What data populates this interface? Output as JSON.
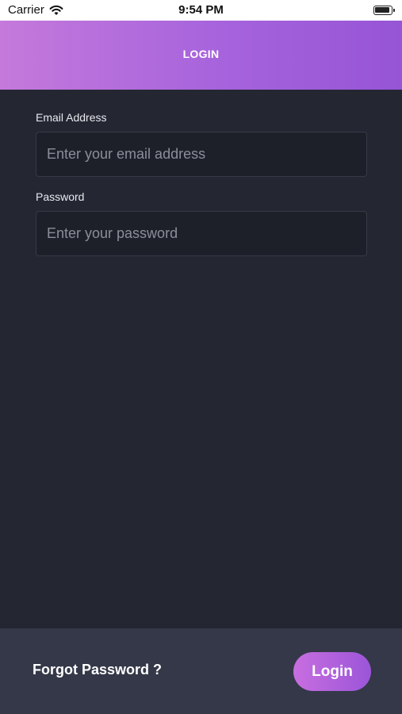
{
  "status_bar": {
    "carrier": "Carrier",
    "time": "9:54 PM",
    "wifi_icon": "wifi-icon",
    "battery_icon": "battery-icon"
  },
  "header": {
    "title": "LOGIN"
  },
  "form": {
    "email": {
      "label": "Email Address",
      "value": "",
      "placeholder": "Enter your email address"
    },
    "password": {
      "label": "Password",
      "value": "",
      "placeholder": "Enter your password"
    }
  },
  "footer": {
    "forgot_label": "Forgot Password ?",
    "login_label": "Login"
  },
  "colors": {
    "background": "#242732",
    "footer": "#343848",
    "accent_start": "#c479db",
    "accent_end": "#9655d6"
  }
}
